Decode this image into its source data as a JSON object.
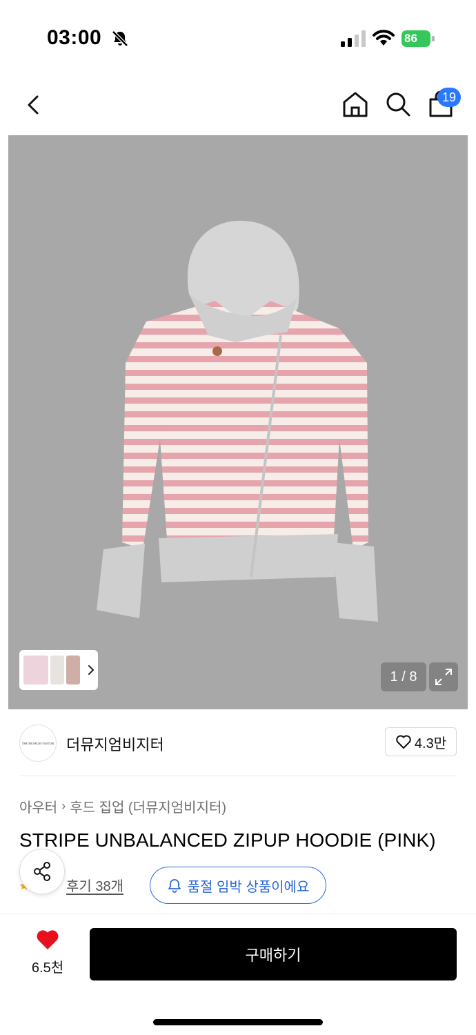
{
  "status_bar": {
    "time": "03:00",
    "battery": "86"
  },
  "nav": {
    "cart_count": "19"
  },
  "gallery": {
    "pager": "1 / 8"
  },
  "brand": {
    "name": "더뮤지엄비지터",
    "logo_text": "THE MUSEUM VISITOR",
    "like_count": "4.3만"
  },
  "breadcrumb": {
    "category": "아우터",
    "subcategory": "후드 집업 (더뮤지엄비지터)"
  },
  "product": {
    "title": "STRIPE UNBALANCED ZIPUP HOODIE (PINK)",
    "review_label": "후기 38개",
    "soldout_notice": "품절 임박 상품이에요"
  },
  "action_bar": {
    "wish_count": "6.5천",
    "buy_label": "구매하기"
  },
  "colors": {
    "accent_blue": "#2a67d8",
    "badge_blue": "#2979ff",
    "heart_red": "#e8101e",
    "battery_green": "#34c759"
  }
}
